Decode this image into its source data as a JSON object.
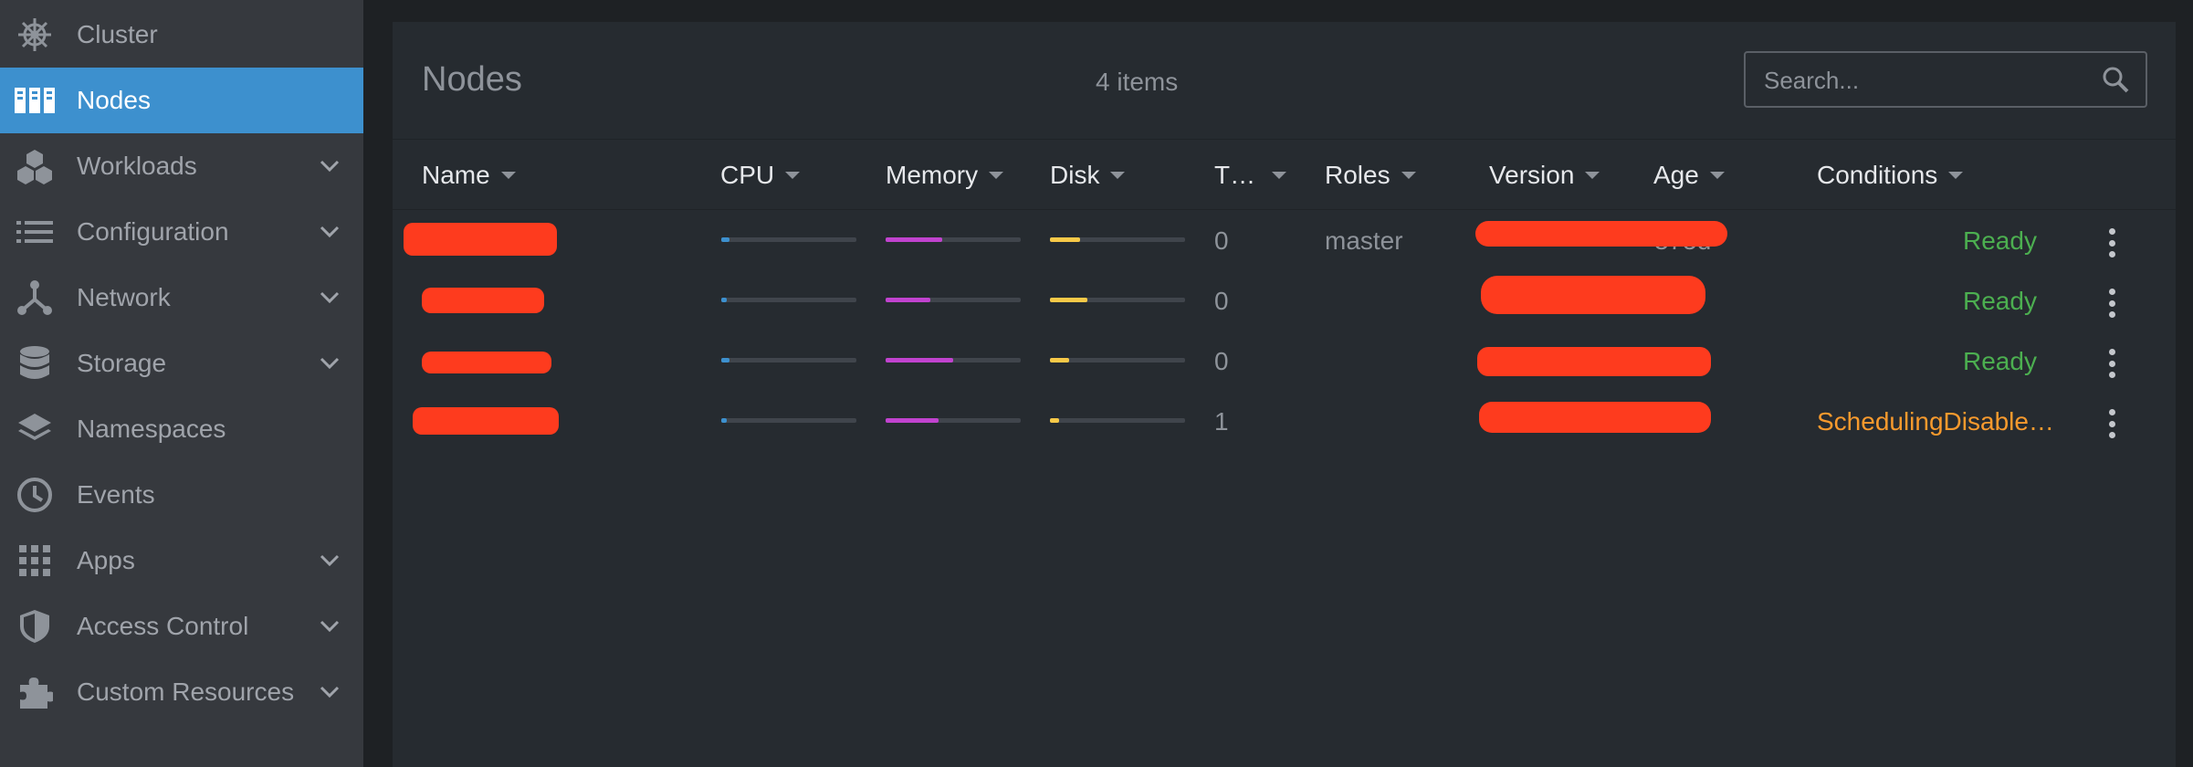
{
  "sidebar": {
    "items": [
      {
        "label": "Cluster",
        "icon": "helm-wheel-icon",
        "active": false,
        "expandable": false
      },
      {
        "label": "Nodes",
        "icon": "nodes-icon",
        "active": true,
        "expandable": false
      },
      {
        "label": "Workloads",
        "icon": "cubes-icon",
        "active": false,
        "expandable": true
      },
      {
        "label": "Configuration",
        "icon": "list-icon",
        "active": false,
        "expandable": true
      },
      {
        "label": "Network",
        "icon": "network-icon",
        "active": false,
        "expandable": true
      },
      {
        "label": "Storage",
        "icon": "database-icon",
        "active": false,
        "expandable": true
      },
      {
        "label": "Namespaces",
        "icon": "layers-icon",
        "active": false,
        "expandable": false
      },
      {
        "label": "Events",
        "icon": "clock-icon",
        "active": false,
        "expandable": false
      },
      {
        "label": "Apps",
        "icon": "apps-grid-icon",
        "active": false,
        "expandable": true
      },
      {
        "label": "Access Control",
        "icon": "shield-icon",
        "active": false,
        "expandable": true
      },
      {
        "label": "Custom Resources",
        "icon": "puzzle-icon",
        "active": false,
        "expandable": true
      }
    ]
  },
  "main": {
    "title": "Nodes",
    "items_count": "4 items",
    "search": {
      "placeholder": "Search..."
    },
    "columns": [
      "Name",
      "CPU",
      "Memory",
      "Disk",
      "T…",
      "Roles",
      "Version",
      "Age",
      "Conditions"
    ],
    "rows": [
      {
        "cpu": 0.06,
        "memory": 0.42,
        "disk": 0.22,
        "taints": "0",
        "roles": "master",
        "age": "375d",
        "condition": "Ready",
        "condition_status": "ok"
      },
      {
        "cpu": 0.04,
        "memory": 0.33,
        "disk": 0.28,
        "taints": "0",
        "roles": "",
        "age": "",
        "condition": "Ready",
        "condition_status": "ok"
      },
      {
        "cpu": 0.06,
        "memory": 0.5,
        "disk": 0.14,
        "taints": "0",
        "roles": "",
        "age": "",
        "condition": "Ready",
        "condition_status": "ok"
      },
      {
        "cpu": 0.04,
        "memory": 0.39,
        "disk": 0.07,
        "taints": "1",
        "roles": "",
        "age": "",
        "condition": "SchedulingDisable…",
        "condition_status": "warning"
      }
    ]
  },
  "colors": {
    "active_nav": "#3d90ce",
    "cpu_bar": "#3d90ce",
    "memory_bar": "#c143cf",
    "disk_bar": "#f7c948",
    "ready": "#4caf50",
    "warning": "#f89a2d",
    "redaction": "#fe3b1e"
  }
}
